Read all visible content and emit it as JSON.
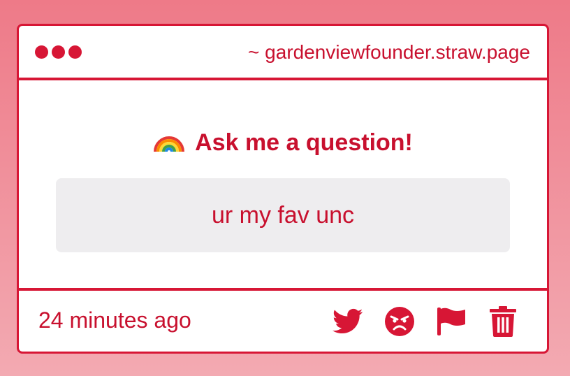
{
  "window": {
    "url": "~ gardenviewfounder.straw.page"
  },
  "main": {
    "heading_icon": "rainbow-icon",
    "heading": "Ask me a question!",
    "question": "ur my fav unc"
  },
  "footer": {
    "timestamp": "24 minutes ago",
    "actions": [
      {
        "icon": "twitter-icon"
      },
      {
        "icon": "angry-face-icon"
      },
      {
        "icon": "flag-icon"
      },
      {
        "icon": "trash-icon"
      }
    ]
  },
  "colors": {
    "accent": "#d71635",
    "text": "#c8102e",
    "question_bg": "#eeedef",
    "background_top": "#ee7a88",
    "background_bottom": "#f3aab2"
  }
}
